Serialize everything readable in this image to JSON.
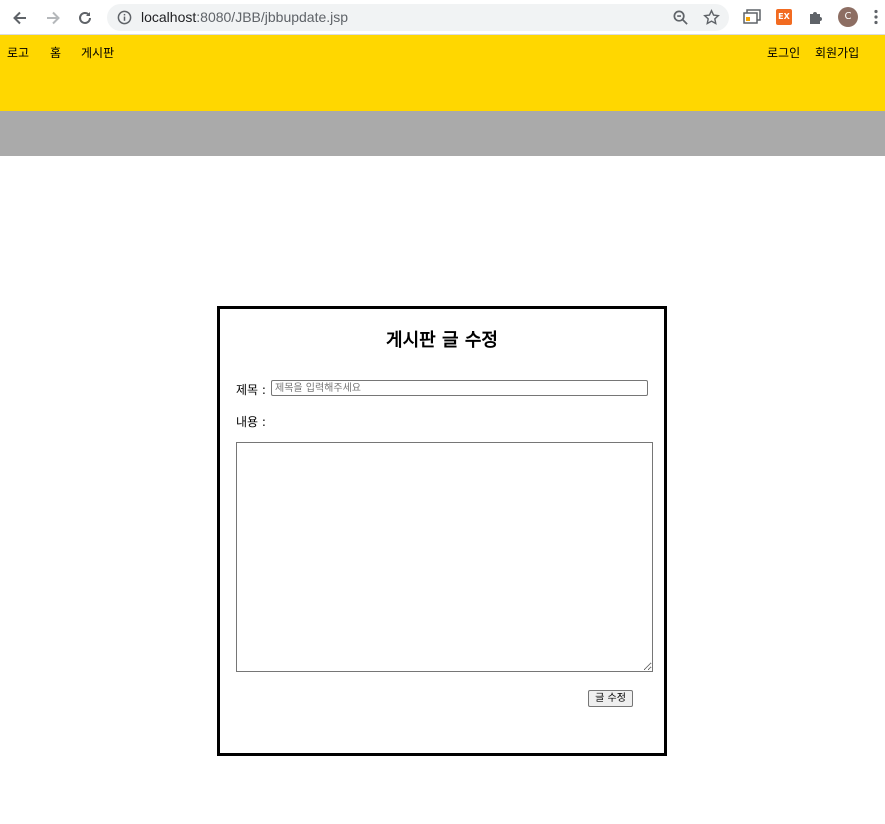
{
  "browser": {
    "url_host": "localhost",
    "url_path": ":8080/JBB/jbbupdate.jsp",
    "profile_initial": "C",
    "extension_label": "EX"
  },
  "header": {
    "logo": "로고",
    "home": "홈",
    "board": "게시판",
    "login": "로그인",
    "signup": "회원가입"
  },
  "form": {
    "title": "게시판 글 수정",
    "subject_label": "제목 :",
    "subject_placeholder": "제목을 입력해주세요",
    "subject_value": "",
    "content_label": "내용 :",
    "content_value": "",
    "submit_label": "글 수정"
  },
  "colors": {
    "header_bg": "#FFD700",
    "subbar_bg": "#AAAAAA",
    "avatar_bg": "#8D6E63",
    "extension_bg": "#F26B21"
  }
}
